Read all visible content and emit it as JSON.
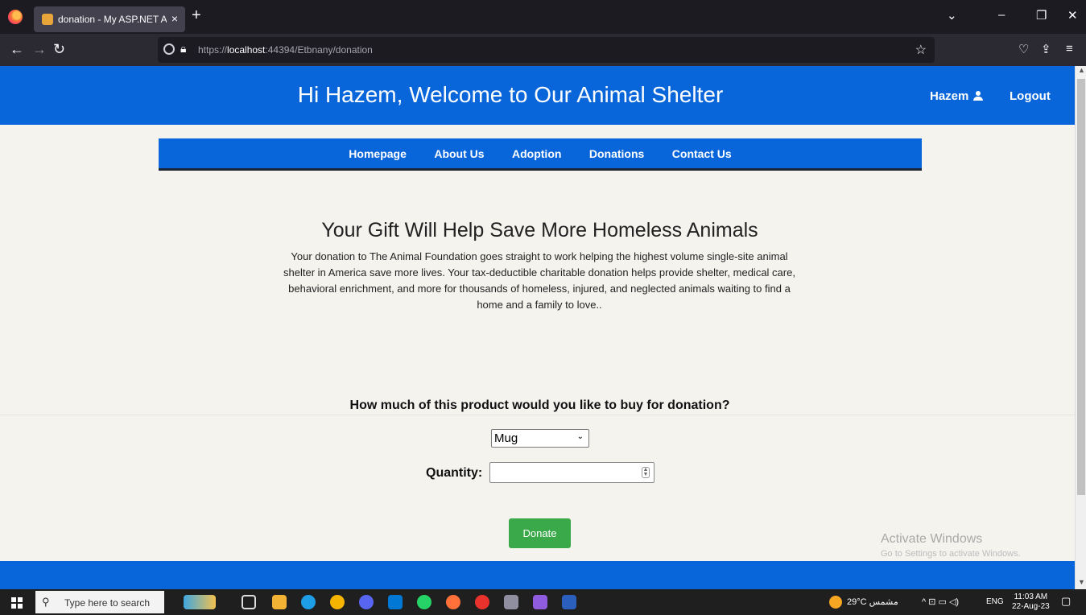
{
  "browser": {
    "tab_title": "donation - My ASP.NET Applica",
    "tab_close": "×",
    "new_tab": "+",
    "url_prefix": "https://",
    "url_host": "localhost",
    "url_rest": ":44394/Etbnany/donation"
  },
  "header": {
    "welcome": "Hi Hazem, Welcome to Our Animal Shelter",
    "user_name": "Hazem",
    "logout": "Logout"
  },
  "nav": {
    "items": [
      {
        "label": "Homepage"
      },
      {
        "label": "About Us"
      },
      {
        "label": "Adoption"
      },
      {
        "label": "Donations"
      },
      {
        "label": "Contact Us"
      }
    ]
  },
  "main": {
    "heading": "Your Gift Will Help Save More Homeless Animals",
    "paragraph": "Your donation to The Animal Foundation goes straight to work helping the highest volume single-site animal shelter in America save more lives. Your tax-deductible charitable donation helps provide shelter, medical care, behavioral enrichment, and more for thousands of homeless, injured, and neglected animals waiting to find a home and a family to love.."
  },
  "form": {
    "question": "How much of this product would you like to buy for donation?",
    "product_selected": "Mug",
    "quantity_label": "Quantity:",
    "quantity_value": "",
    "donate_label": "Donate"
  },
  "watermark": {
    "line1": "Activate Windows",
    "line2": "Go to Settings to activate Windows."
  },
  "taskbar": {
    "search_placeholder": "Type here to search",
    "weather": "29°C  مشمس",
    "language": "ENG",
    "time": "11:03 AM",
    "date": "22-Aug-23"
  },
  "colors": {
    "brand_blue": "#0866da",
    "donate_green": "#3aa94a",
    "page_bg": "#f5f3ee"
  },
  "icons": [
    "firefox-icon",
    "back-icon",
    "forward-icon",
    "reload-icon",
    "shield-icon",
    "lock-icon",
    "star-icon",
    "pocket-icon",
    "share-icon",
    "menu-icon",
    "user-icon",
    "windows-start-icon",
    "search-icon"
  ]
}
